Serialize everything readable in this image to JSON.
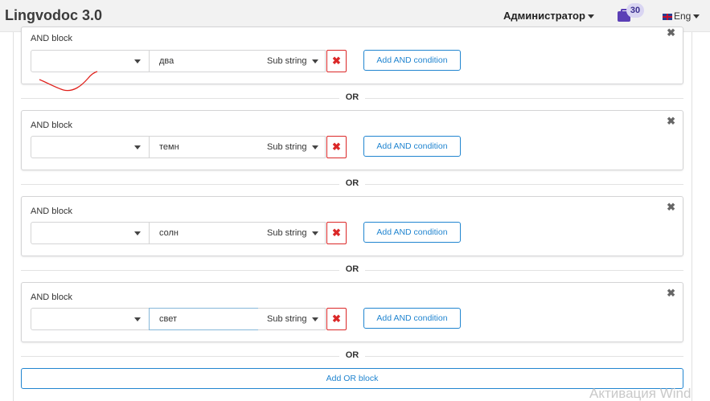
{
  "header": {
    "brand": "Lingvodoc 3.0",
    "user_menu": "Администратор",
    "tasks_badge": "30",
    "language": "Eng"
  },
  "and_blocks": [
    {
      "title": "AND block",
      "value": "два",
      "match_type": "Sub string",
      "add_and_label": "Add AND condition"
    },
    {
      "title": "AND block",
      "value": "темн",
      "match_type": "Sub string",
      "add_and_label": "Add AND condition"
    },
    {
      "title": "AND block",
      "value": "солн",
      "match_type": "Sub string",
      "add_and_label": "Add AND condition"
    },
    {
      "title": "AND block",
      "value": "свет",
      "match_type": "Sub string",
      "add_and_label": "Add AND condition"
    }
  ],
  "or_label": "OR",
  "add_or_label": "Add OR block",
  "watermark": "Активация Wind",
  "colors": {
    "accent": "#2185d0",
    "danger": "#db2828",
    "badge": "#5b3fb6"
  }
}
